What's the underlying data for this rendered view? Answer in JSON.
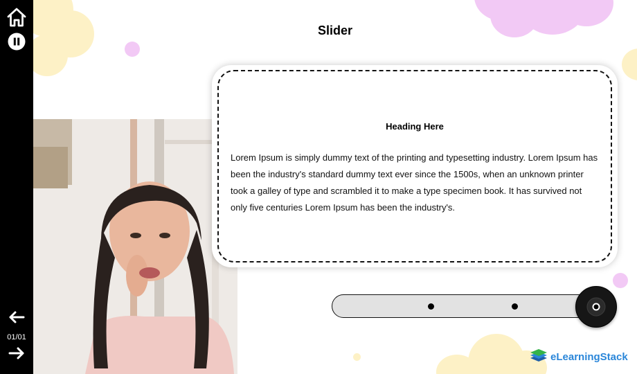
{
  "title": "Slider",
  "card": {
    "heading": "Heading Here",
    "body": "Lorem Ipsum is simply dummy text of the printing and typesetting industry. Lorem Ipsum has been the industry's standard dummy text ever since the 1500s, when an unknown printer took a galley of type and scrambled it to make a type specimen book. It has survived not only five centuries Lorem Ipsum has been the industry's."
  },
  "nav": {
    "page_indicator": "01/01"
  },
  "icons": {
    "home": "home-icon",
    "pause": "pause-icon",
    "prev": "arrow-left-icon",
    "next": "arrow-right-icon",
    "logo": "book-stack-icon"
  },
  "logo": {
    "text": "eLearningStack"
  },
  "slider": {
    "stops": 3,
    "position": 1.0
  },
  "colors": {
    "sidebar": "#000000",
    "accent_pink": "#f2c9f5",
    "accent_yellow": "#fdf1c6",
    "logo_blue": "#2a86d9",
    "logo_green": "#35b34a"
  }
}
